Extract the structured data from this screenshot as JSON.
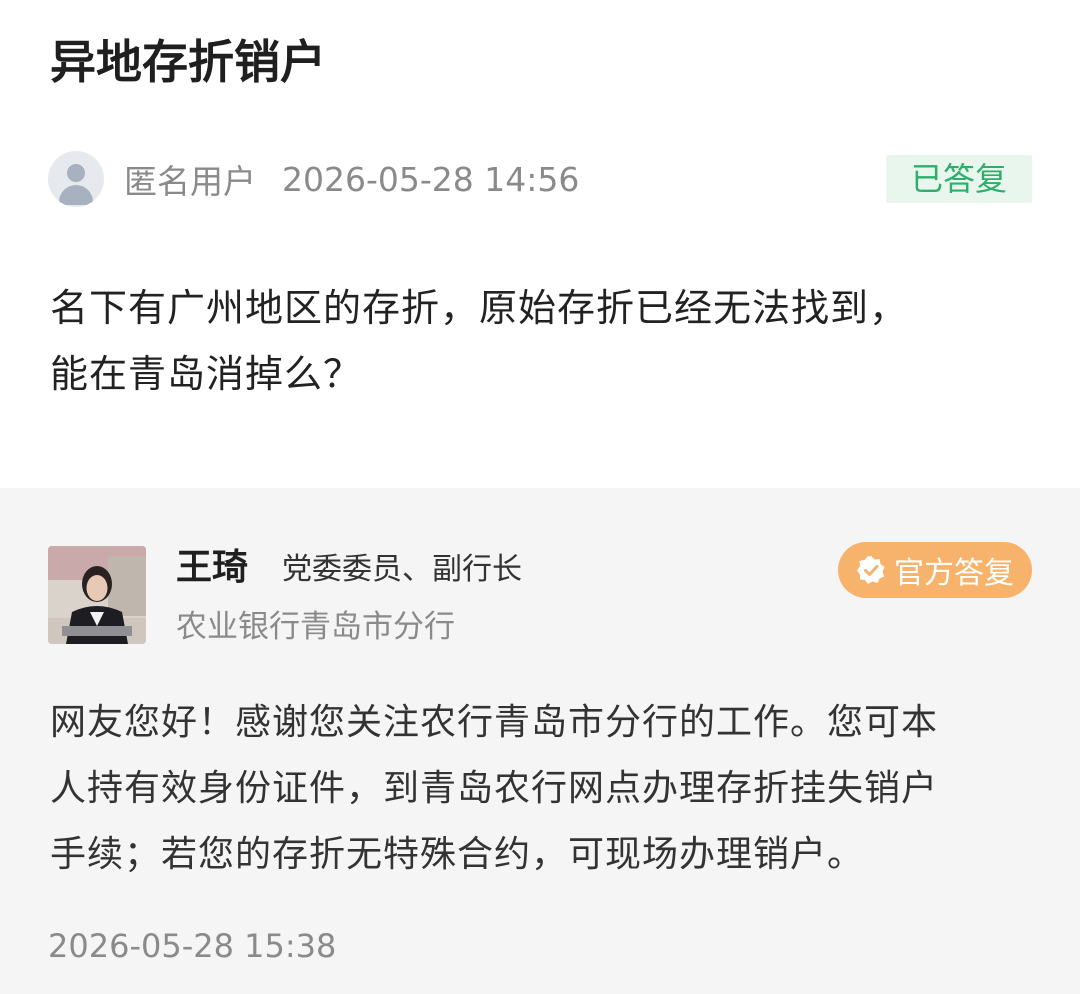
{
  "question": {
    "title": "异地存折销户",
    "user": "匿名用户",
    "time": "2026-05-28 14:56",
    "status": "已答复",
    "body_lines": [
      "名下有广州地区的存折，原始存折已经无法找到，",
      "能在青岛消掉么？"
    ]
  },
  "answer": {
    "name": "王琦",
    "title": "党委委员、副行长",
    "organization": "农业银行青岛市分行",
    "badge": "官方答复",
    "body_lines": [
      "网友您好！感谢您关注农行青岛市分行的工作。您可本",
      "人持有效身份证件，到青岛农行网点办理存折挂失销户",
      "手续；若您的存折无特殊合约，可现场办理销户。"
    ],
    "time": "2026-05-28 15:38"
  },
  "colors": {
    "status_green": "#2fae6b",
    "status_bg": "#e8f6ee",
    "official_orange": "#f7b36b",
    "answer_bg": "#f5f5f5"
  },
  "icons": {
    "anon_avatar": "default-user-avatar-icon",
    "verified": "checkmark-badge-icon"
  }
}
